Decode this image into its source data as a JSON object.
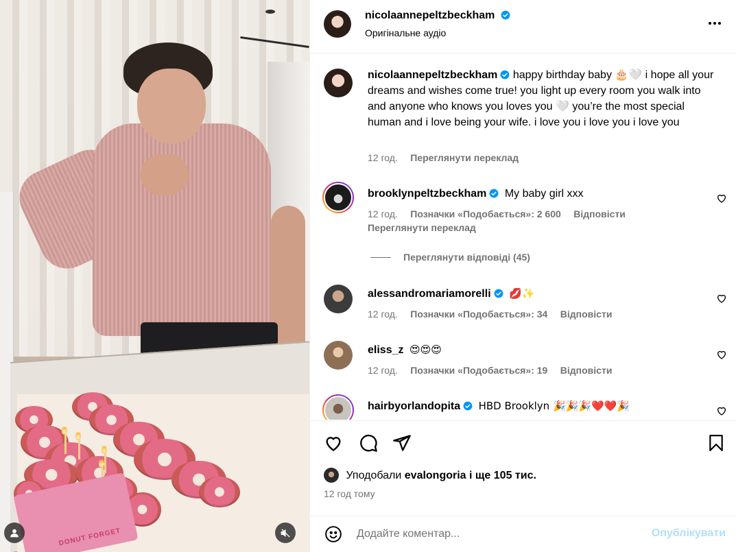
{
  "post": {
    "author": "nicolaannepeltzbeckham",
    "audio": "Оригінальне аудіо",
    "caption": "happy birthday baby 🎂🤍 i hope all your dreams and wishes come true! you light up every room you walk into and anyone who knows you loves you 🤍 you’re the most special human and i love being your wife. i love you i love you i love you",
    "caption_time": "12 год.",
    "caption_translate": "Переглянути переклад",
    "media_overlay": {
      "donut_box_label": "DONUT FORGET"
    }
  },
  "comments": [
    {
      "username": "brooklynpeltzbeckham",
      "text": "My baby girl xxx",
      "time": "12 год.",
      "likes": "Позначки «Подобається»: 2 600",
      "reply": "Відповісти",
      "translate": "Переглянути переклад",
      "view_replies": "Переглянути відповіді (45)"
    },
    {
      "username": "alessandromariamorelli",
      "text": "💋✨",
      "time": "12 год.",
      "likes": "Позначки «Подобається»: 34",
      "reply": "Відповісти"
    },
    {
      "username": "eliss_z",
      "text": "😍😍😍",
      "time": "12 год.",
      "likes": "Позначки «Подобається»: 19",
      "reply": "Відповісти"
    },
    {
      "username": "hairbyorlandopita",
      "text": "HBD Brooklyn 🎉🎉🎉❤️❤️🎉"
    }
  ],
  "likes_summary": {
    "prefix": "Уподобали",
    "user": "evalongoria",
    "suffix": "і ще 105 тис."
  },
  "post_time": "12 год тому",
  "composer": {
    "placeholder": "Додайте коментар...",
    "post_label": "Опублікувати"
  },
  "colors": {
    "verified": "#0095f6",
    "meta": "#737373",
    "post_disabled": "#b2dffc"
  }
}
